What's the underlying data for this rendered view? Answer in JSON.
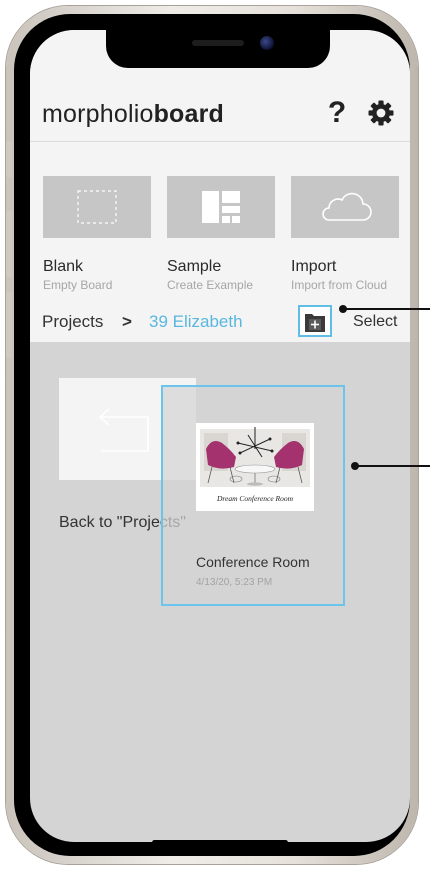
{
  "app": {
    "logo_regular": "morpholio",
    "logo_bold": "board",
    "help_label": "?"
  },
  "create_options": [
    {
      "label": "Blank",
      "sub": "Empty Board",
      "icon": "blank-board-icon"
    },
    {
      "label": "Sample",
      "sub": "Create Example",
      "icon": "layout-grid-icon"
    },
    {
      "label": "Import",
      "sub": "Import from Cloud",
      "icon": "cloud-icon"
    }
  ],
  "breadcrumb": {
    "root": "Projects",
    "separator": ">",
    "current": "39 Elizabeth"
  },
  "toolbar": {
    "new_folder_icon": "folder-plus-icon",
    "select_label": "Select"
  },
  "back_item": {
    "label": "Back to \"Projects\"",
    "icon": "back-arrow-icon"
  },
  "boards": [
    {
      "title": "Conference Room",
      "date": "4/13/20, 5:23 PM",
      "thumbnail_caption": "Dream Conference Room"
    }
  ],
  "colors": {
    "accent": "#5ab7e0",
    "selection_border": "#6cc4ec",
    "tile_bg": "#c6c6c6",
    "content_bg": "#d4d4d4",
    "chair": "#a3326f"
  }
}
